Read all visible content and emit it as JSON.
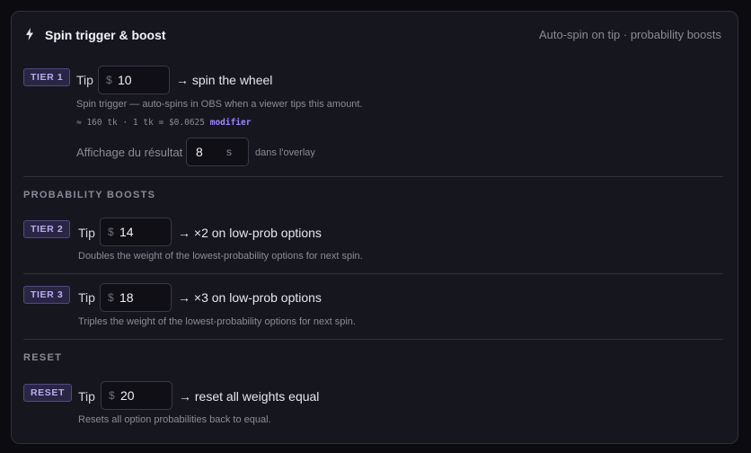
{
  "header": {
    "title": "Spin trigger & boost",
    "subtitle": "Auto-spin on tip · probability boosts",
    "icon": "bolt-icon"
  },
  "tier1": {
    "badge": "TIER 1",
    "tip_label": "Tip",
    "currency": "$",
    "amount": "10",
    "action": "→ spin the wheel",
    "description": "Spin trigger — auto-spins in OBS when a viewer tips this amount.",
    "conversion": "≈ 160 tk · 1 tk = $0.0625",
    "modifier_link": "modifier",
    "display_label": "Affichage du résultat",
    "display_seconds": "8",
    "seconds_unit": "s",
    "overlay_label": "dans l'overlay"
  },
  "boosts": {
    "section_title": "PROBABILITY BOOSTS",
    "tier2": {
      "badge": "TIER 2",
      "tip_label": "Tip",
      "currency": "$",
      "amount": "14",
      "action": "→ ×2 on low-prob options",
      "description": "Doubles the weight of the lowest-probability options for next spin."
    },
    "tier3": {
      "badge": "TIER 3",
      "tip_label": "Tip",
      "currency": "$",
      "amount": "18",
      "action": "→ ×3 on low-prob options",
      "description": "Triples the weight of the lowest-probability options for next spin."
    }
  },
  "reset": {
    "section_title": "RESET",
    "badge": "RESET",
    "tip_label": "Tip",
    "currency": "$",
    "amount": "20",
    "action": "→ reset all weights equal",
    "description": "Resets all option probabilities back to equal."
  },
  "colors": {
    "accent": "#9d84ff",
    "badge_bg": "#2a2544",
    "card_bg": "#16161e",
    "page_bg": "#0c0c10"
  }
}
